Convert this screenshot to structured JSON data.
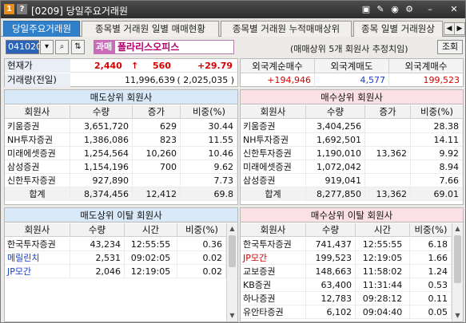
{
  "window": {
    "badge1": "1",
    "badge2": "?",
    "title": "[0209] 당일주요거래원",
    "controls": [
      "▣",
      "✎",
      "◉",
      "⚙",
      "–",
      "✕"
    ],
    "icons": [
      "layout-icon",
      "edit-icon",
      "camera-icon",
      "gear-icon",
      "minimize-icon",
      "close-icon"
    ]
  },
  "tabs": [
    {
      "label": "당일주요거래원",
      "active": true
    },
    {
      "label": "종목별 거래원 일별 매매현황",
      "active": false
    },
    {
      "label": "종목별 거래원 누적매매상위",
      "active": false
    },
    {
      "label": "종목 일별 거래원상",
      "active": false
    }
  ],
  "toolbar": {
    "code": "041020",
    "tax_badge": "과매",
    "stock_name": "폴라리스오피스",
    "note": "(매매상위 5개 회원사 추정치임)",
    "query_label": "조회"
  },
  "info": {
    "price_label": "현재가",
    "price": "2,440",
    "arrow": "↑",
    "change": "560",
    "change_pct": "+29.79",
    "volume_label": "거래량(전일)",
    "volume": "11,996,639",
    "prev_volume": "( 2,025,035 )"
  },
  "foreign": {
    "headers": [
      "외국계순매수",
      "외국계매도",
      "외국계매수"
    ],
    "values": [
      "+194,946",
      "4,577",
      "199,523"
    ]
  },
  "sell_top": {
    "title": "매도상위 회원사",
    "headers": [
      "회원사",
      "수량",
      "증가",
      "비중(%)"
    ],
    "rows": [
      [
        "키움증권",
        "3,651,720",
        "629",
        "30.44"
      ],
      [
        "NH투자증권",
        "1,386,086",
        "823",
        "11.55"
      ],
      [
        "미래에셋증권",
        "1,254,564",
        "10,260",
        "10.46"
      ],
      [
        "삼성증권",
        "1,154,196",
        "700",
        "9.62"
      ],
      [
        "신한투자증권",
        "927,890",
        "",
        "7.73"
      ]
    ],
    "sum": [
      "합계",
      "8,374,456",
      "12,412",
      "69.8"
    ]
  },
  "buy_top": {
    "title": "매수상위 회원사",
    "headers": [
      "회원사",
      "수량",
      "증가",
      "비중(%)"
    ],
    "rows": [
      [
        "키움증권",
        "3,404,256",
        "",
        "28.38"
      ],
      [
        "NH투자증권",
        "1,692,501",
        "",
        "14.11"
      ],
      [
        "신한투자증권",
        "1,190,010",
        "13,362",
        "9.92"
      ],
      [
        "미래에셋증권",
        "1,072,042",
        "",
        "8.94"
      ],
      [
        "삼성증권",
        "919,041",
        "",
        "7.66"
      ]
    ],
    "sum": [
      "합계",
      "8,277,850",
      "13,362",
      "69.01"
    ]
  },
  "sell_break": {
    "title": "매도상위 이탈 회원사",
    "headers": [
      "회원사",
      "수량",
      "시간",
      "비중(%)"
    ],
    "rows": [
      {
        "cells": [
          "한국투자증권",
          "43,234",
          "12:55:55",
          "0.36"
        ],
        "color": ""
      },
      {
        "cells": [
          "메릴린치",
          "2,531",
          "09:02:05",
          "0.02"
        ],
        "color": "blue"
      },
      {
        "cells": [
          "JP모간",
          "2,046",
          "12:19:05",
          "0.02"
        ],
        "color": "blue"
      }
    ]
  },
  "buy_break": {
    "title": "매수상위 이탈 회원사",
    "headers": [
      "회원사",
      "수량",
      "시간",
      "비중(%)"
    ],
    "rows": [
      {
        "cells": [
          "한국투자증권",
          "741,437",
          "12:55:55",
          "6.18"
        ],
        "color": ""
      },
      {
        "cells": [
          "JP모간",
          "199,523",
          "12:19:05",
          "1.66"
        ],
        "color": "red"
      },
      {
        "cells": [
          "교보증권",
          "148,663",
          "11:58:02",
          "1.24"
        ],
        "color": ""
      },
      {
        "cells": [
          "KB증권",
          "63,400",
          "11:31:44",
          "0.53"
        ],
        "color": ""
      },
      {
        "cells": [
          "하나증권",
          "12,783",
          "09:28:12",
          "0.11"
        ],
        "color": ""
      },
      {
        "cells": [
          "유안타증권",
          "6,102",
          "09:04:40",
          "0.05"
        ],
        "color": ""
      }
    ]
  },
  "colors": {
    "accent": "#2f7fc9",
    "red": "#d50000",
    "blue": "#1a3fc4",
    "pink_panel": "#fbe1e6",
    "blue_panel": "#d9e9f8"
  }
}
